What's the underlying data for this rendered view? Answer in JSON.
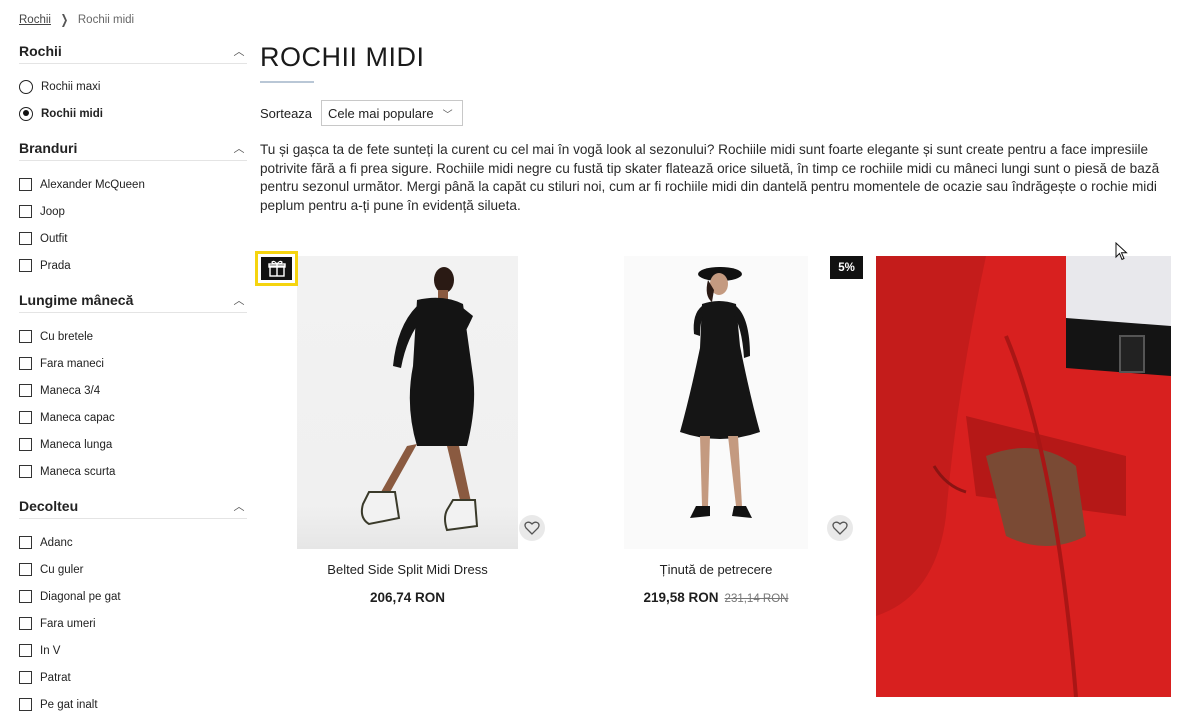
{
  "breadcrumb": {
    "root": "Rochii",
    "current": "Rochii midi"
  },
  "sidebar": {
    "sections": [
      {
        "title": "Rochii",
        "type": "radio",
        "items": [
          {
            "label": "Rochii maxi",
            "selected": false
          },
          {
            "label": "Rochii midi",
            "selected": true
          }
        ]
      },
      {
        "title": "Branduri",
        "type": "checkbox",
        "items": [
          {
            "label": "Alexander McQueen"
          },
          {
            "label": "Joop"
          },
          {
            "label": "Outfit"
          },
          {
            "label": "Prada"
          }
        ]
      },
      {
        "title": "Lungime mânecă",
        "type": "checkbox",
        "items": [
          {
            "label": "Cu bretele"
          },
          {
            "label": "Fara maneci"
          },
          {
            "label": "Maneca 3/4"
          },
          {
            "label": "Maneca capac"
          },
          {
            "label": "Maneca lunga"
          },
          {
            "label": "Maneca scurta"
          }
        ]
      },
      {
        "title": "Decolteu",
        "type": "checkbox",
        "items": [
          {
            "label": "Adanc"
          },
          {
            "label": "Cu guler"
          },
          {
            "label": "Diagonal pe gat"
          },
          {
            "label": "Fara umeri"
          },
          {
            "label": "In V"
          },
          {
            "label": "Patrat"
          },
          {
            "label": "Pe gat inalt"
          }
        ]
      }
    ]
  },
  "main": {
    "title": "ROCHII MIDI",
    "sort": {
      "label": "Sorteaza",
      "value": "Cele mai populare"
    },
    "description": "Tu și gașca ta de fete sunteți la curent cu cel mai în vogă look al sezonului? Rochiile midi sunt foarte elegante și sunt create pentru a face impresiile potrivite fără a fi prea sigure. Rochiile midi negre cu fustă tip skater flatează orice siluetă, în timp ce rochiile midi cu mâneci lungi sunt o piesă de bază pentru sezonul următor. Mergi până la capăt cu stiluri noi, cum ar fi rochiile midi din dantelă pentru momentele de ocazie sau îndrăgește o rochie midi peplum pentru a-ți pune în evidență silueta."
  },
  "products": [
    {
      "name": "Belted Side Split Midi Dress",
      "price": "206,74 RON"
    },
    {
      "name": "Ținută de petrecere",
      "price": "219,58 RON",
      "old_price": "231,14 RON",
      "discount": "5%"
    }
  ],
  "colors": {
    "badge_yellow": "#f5d40f",
    "promo_red": "#d8201f"
  }
}
